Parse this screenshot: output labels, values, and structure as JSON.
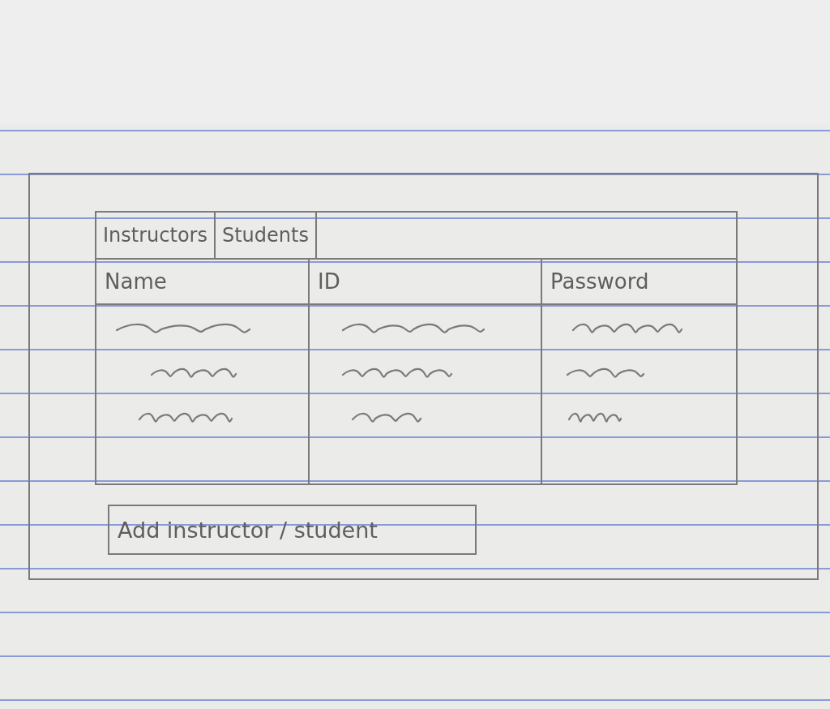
{
  "tabs": [
    {
      "label": "Instructors"
    },
    {
      "label": "Students"
    }
  ],
  "table": {
    "columns": [
      "Name",
      "ID",
      "Password"
    ],
    "rows": [
      {
        "cells": [
          {
            "kind": "scribble"
          },
          {
            "kind": "scribble"
          },
          {
            "kind": "scribble"
          }
        ]
      },
      {
        "cells": [
          {
            "kind": "scribble"
          },
          {
            "kind": "scribble"
          },
          {
            "kind": "scribble"
          }
        ]
      },
      {
        "cells": [
          {
            "kind": "scribble"
          },
          {
            "kind": "scribble"
          },
          {
            "kind": "scribble"
          }
        ]
      },
      {
        "cells": [
          {
            "kind": "empty"
          },
          {
            "kind": "empty"
          },
          {
            "kind": "empty"
          }
        ]
      }
    ]
  },
  "button": {
    "label": "Add instructor / student"
  }
}
